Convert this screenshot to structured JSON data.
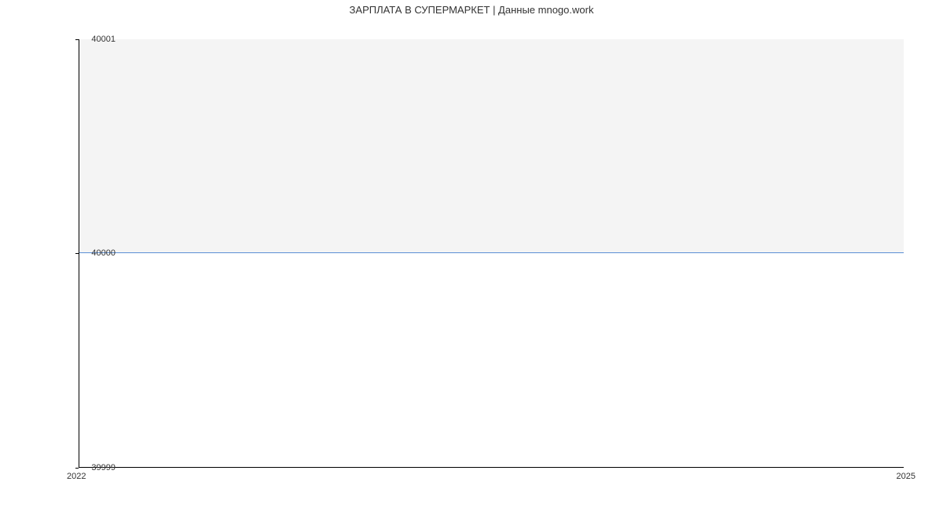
{
  "chart_data": {
    "type": "line",
    "title": "ЗАРПЛАТА В СУПЕРМАРКЕТ | Данные mnogo.work",
    "xlabel": "",
    "ylabel": "",
    "x": [
      2022,
      2025
    ],
    "values": [
      40000,
      40000
    ],
    "xlim": [
      2022,
      2025
    ],
    "ylim": [
      39999,
      40001
    ],
    "y_ticks": [
      39999,
      40000,
      40001
    ],
    "x_ticks": [
      2022,
      2025
    ],
    "line_color": "#5b8fd6",
    "fill_color": "#f4f4f4"
  }
}
